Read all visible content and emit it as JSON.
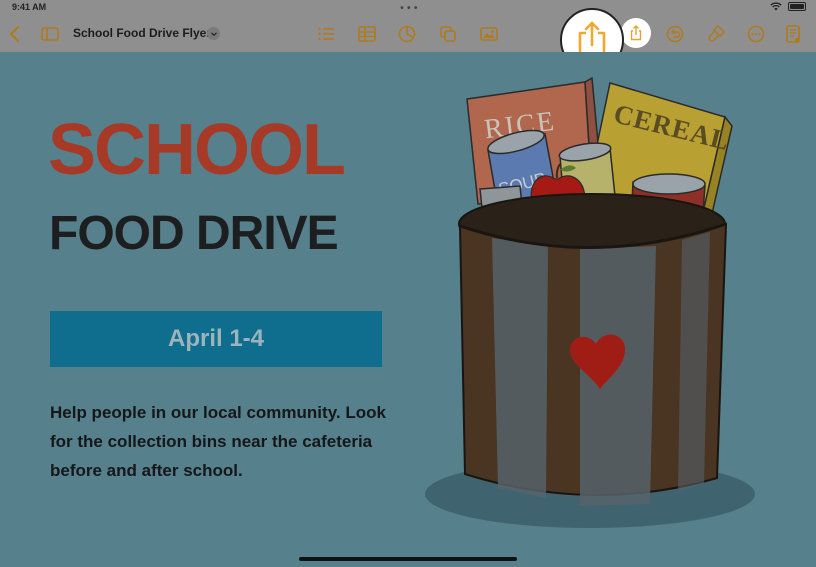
{
  "status": {
    "time": "9:41 AM",
    "multitask_dots": "•••"
  },
  "toolbar": {
    "doc_title": "School Food Drive Flyer",
    "icons": [
      "back-icon",
      "sidebar-icon",
      "list-icon",
      "table-icon",
      "chart-icon",
      "shapes-icon",
      "media-icon",
      "share-icon",
      "undo-icon",
      "format-brush-icon",
      "more-icon",
      "document-setup-icon"
    ]
  },
  "flyer": {
    "headline": "SCHOOL",
    "subheadline": "FOOD DRIVE",
    "date": "April 1-4",
    "blurb": "Help people in our local community. Look for the collection bins near the cafeteria before and after school."
  },
  "art_labels": {
    "rice": "RICE",
    "cereal": "CEREAL",
    "soup": "SOUP"
  },
  "colors": {
    "accent": "#f0a830",
    "headline": "#a63a26",
    "date_box": "#0f6d8e",
    "background": "#56808c",
    "toolbar": "#8f8f8f"
  }
}
